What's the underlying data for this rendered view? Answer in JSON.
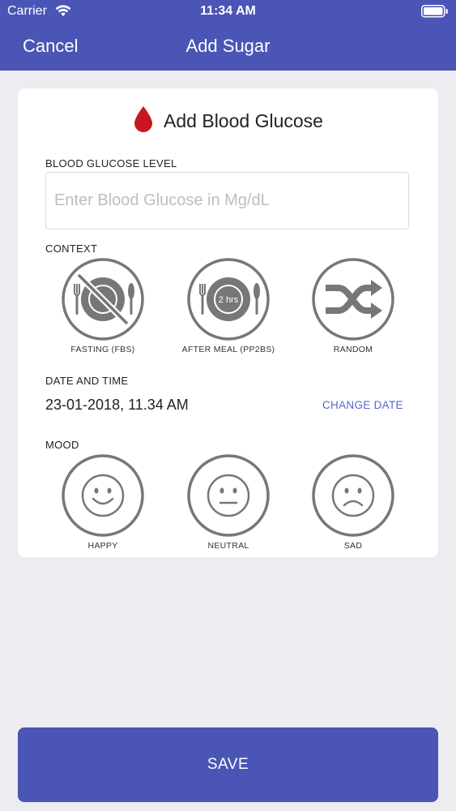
{
  "status_bar": {
    "carrier": "Carrier",
    "time": "11:34 AM"
  },
  "nav": {
    "cancel_label": "Cancel",
    "title": "Add Sugar"
  },
  "card": {
    "title": "Add Blood Glucose",
    "glucose": {
      "label": "BLOOD GLUCOSE LEVEL",
      "value": "",
      "placeholder": "Enter Blood Glucose in Mg/dL"
    },
    "context": {
      "label": "CONTEXT",
      "options": [
        {
          "label": "FASTING (FBS)",
          "icon": "fasting-plate-icon"
        },
        {
          "label": "AFTER MEAL (PP2BS)",
          "icon": "after-meal-plate-icon",
          "badge": "2 hrs"
        },
        {
          "label": "RANDOM",
          "icon": "shuffle-icon"
        }
      ]
    },
    "datetime": {
      "label": "DATE AND TIME",
      "value": "23-01-2018, 11.34 AM",
      "change_label": "CHANGE DATE"
    },
    "mood": {
      "label": "MOOD",
      "options": [
        {
          "label": "HAPPY",
          "icon": "happy-face-icon"
        },
        {
          "label": "NEUTRAL",
          "icon": "neutral-face-icon"
        },
        {
          "label": "SAD",
          "icon": "sad-face-icon"
        }
      ]
    }
  },
  "save_label": "SAVE",
  "colors": {
    "primary": "#4A55B5",
    "background": "#ECECF1",
    "drop": "#C8171E",
    "icon_gray": "#777777",
    "link": "#5A66C8"
  }
}
